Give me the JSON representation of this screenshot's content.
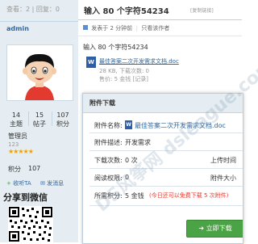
{
  "thread": {
    "stats": "查看：2 | 回复：0",
    "title": "输入 80 个字符54234",
    "copy_link": "[复制链接]"
  },
  "author": {
    "username": "admin",
    "counts": [
      {
        "value": "14",
        "label": "主题"
      },
      {
        "value": "15",
        "label": "帖子"
      },
      {
        "value": "107",
        "label": "积分"
      }
    ],
    "group": "管理员",
    "group_num": "123",
    "stars": "★★★★★",
    "points_label": "积分",
    "points_value": "107",
    "action_pm": "收听TA",
    "action_msg": "发消息",
    "share_title": "分享到微信"
  },
  "post": {
    "meta_posted": "发表于 2 分钟前",
    "meta_author_only": "只看该作者",
    "body": "输入 80 个字符54234",
    "attachment": {
      "file_name": "最佳答案二次开发需求文档.doc",
      "size": "28 KB, 下载次数: 0",
      "price": "售价: 5 金钱  [记录]"
    }
  },
  "dialog": {
    "title": "附件下载",
    "rows": [
      {
        "label": "附件名称:",
        "value": "最佳答案二次开发需求文档.doc"
      },
      {
        "label": "附件描述:",
        "value": "开发需求"
      },
      {
        "label": "下载次数:",
        "value": "0 次",
        "extra": "上传时间"
      },
      {
        "label": "阅读权限:",
        "value": "0",
        "extra": "附件大小"
      },
      {
        "label": "所需积分:",
        "value": "5 金钱",
        "note": "(今日还可以免费下载 5 次附件)"
      }
    ],
    "download_button": "立即下载"
  },
  "watermark": "DS风筝网 dsleague.com"
}
